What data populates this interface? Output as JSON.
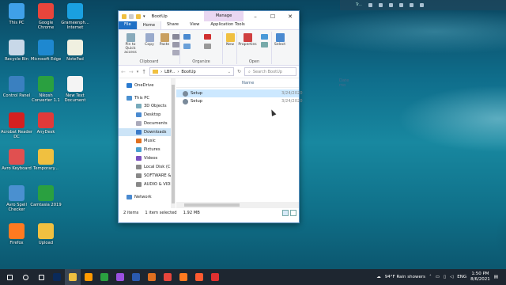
{
  "desktop_icons": [
    {
      "label": "This PC",
      "color": "#3fa0e8"
    },
    {
      "label": "Google Chrome",
      "color": "#e8453c"
    },
    {
      "label": "Grameenph... Internet",
      "color": "#1aa0e0"
    },
    {
      "label": "Recycle Bin",
      "color": "#c8d8e8"
    },
    {
      "label": "Microsoft Edge",
      "color": "#1e88d0"
    },
    {
      "label": "NotePad",
      "color": "#f0f0e0"
    },
    {
      "label": "Control Panel",
      "color": "#3a80c0"
    },
    {
      "label": "Nikosh Converter 1.1",
      "color": "#2aa040"
    },
    {
      "label": "New Text Document",
      "color": "#f4f4f4"
    },
    {
      "label": "Acrobat Reader DC",
      "color": "#d42020"
    },
    {
      "label": "AnyDesk",
      "color": "#e03a3a"
    },
    {
      "label": "Avro Keyboard",
      "color": "#e05050"
    },
    {
      "label": "Temporary...",
      "color": "#f0c040"
    },
    {
      "label": "Avro Spell Checker",
      "color": "#4a90d0"
    },
    {
      "label": "Camtasia 2019",
      "color": "#2aa040"
    },
    {
      "label": "Firefox",
      "color": "#ff7a20"
    },
    {
      "label": "Upload",
      "color": "#f0c040"
    }
  ],
  "window": {
    "title": "BootUp",
    "manage_label": "Manage",
    "tabs": [
      "File",
      "Home",
      "Share",
      "View",
      "Application Tools"
    ],
    "ribbon": {
      "clipboard": {
        "pin": "Pin to Quick access",
        "copy": "Copy",
        "paste": "Paste",
        "label": "Clipboard"
      },
      "organize": {
        "label": "Organize"
      },
      "new": {
        "btn": "New",
        "label": ""
      },
      "open": {
        "properties": "Properties",
        "label": "Open"
      },
      "select": {
        "btn": "Select",
        "label": ""
      }
    },
    "address": {
      "path1": "LBP...",
      "path2": "BootUp",
      "search_placeholder": "Search BootUp"
    },
    "nav_items": [
      "OneDrive",
      "This PC",
      "3D Objects",
      "Desktop",
      "Documents",
      "Downloads",
      "Music",
      "Pictures",
      "Videos",
      "Local Disk (C:)",
      "SOFTWARE & OI",
      "AUDIO & VIDEO",
      "Network"
    ],
    "columns": {
      "name": "Name",
      "date": "Date mo"
    },
    "files": [
      {
        "name": "Setup",
        "date": "3/24/2020",
        "selected": true
      },
      {
        "name": "Setup",
        "date": "3/24/2020",
        "selected": false
      }
    ],
    "status": {
      "items": "2 items",
      "selected": "1 item selected",
      "size": "1.92 MB"
    }
  },
  "widget": {
    "text": "Tr..."
  },
  "taskbar": {
    "icons": [
      "Start",
      "Search",
      "Task View",
      "Photoshop",
      "File Explorer",
      "Illustrator",
      "Camtasia",
      "Premiere",
      "Word",
      "Media Player",
      "Chrome",
      "Firefox",
      "Firefox Dev",
      "Recorder"
    ],
    "weather": "94°F  Rain showers",
    "lang": "ENG",
    "time": "1:50 PM",
    "date": "8/6/2021"
  }
}
